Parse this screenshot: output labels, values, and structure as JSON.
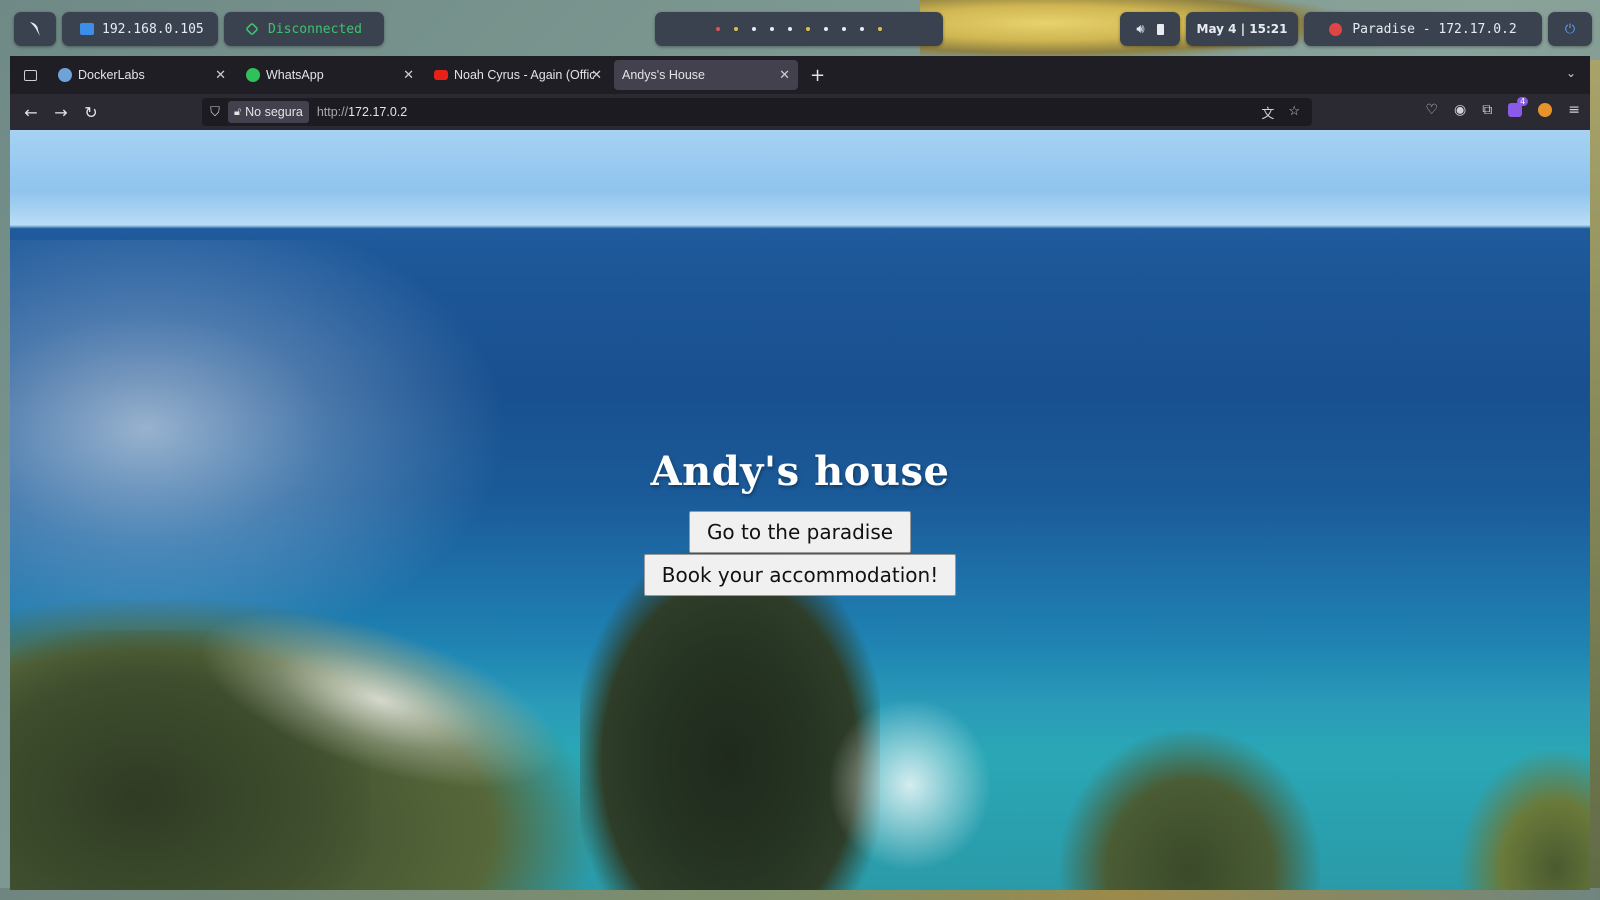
{
  "topbar": {
    "ip": "192.168.0.105",
    "vpn_status": "Disconnected",
    "date_time": "May 4 | 15:21",
    "target": "Paradise - 172.17.0.2"
  },
  "browser": {
    "tabs": [
      {
        "label": "DockerLabs",
        "icon": "dockerlabs-favicon",
        "active": false
      },
      {
        "label": "WhatsApp",
        "icon": "whatsapp-favicon",
        "active": false
      },
      {
        "label": "Noah Cyrus - Again (Offic",
        "icon": "youtube-favicon",
        "active": false
      },
      {
        "label": "Andys's House",
        "icon": "",
        "active": true
      }
    ],
    "security_label": "No segura",
    "url_prefix": "http://",
    "url_host": "172.17.0.2",
    "extension_badge": "4"
  },
  "page": {
    "title": "Andy's house",
    "button_paradise": "Go to the paradise",
    "button_book": "Book your accommodation!"
  },
  "colors": {
    "vpn_green": "#3ec46d",
    "target_red": "#e04545",
    "accent_blue": "#3d8ee8"
  }
}
